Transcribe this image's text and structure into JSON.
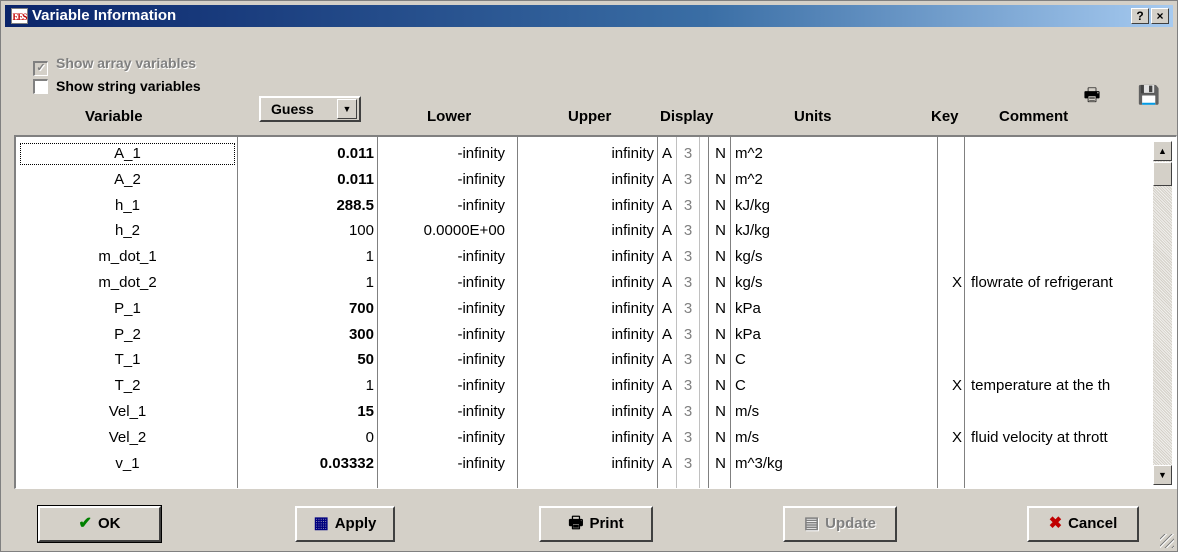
{
  "window": {
    "title": "Variable Information",
    "icon_text": "EES",
    "help_label": "?",
    "close_label": "×"
  },
  "options": {
    "show_array_label": "Show array variables",
    "show_array_checked": true,
    "show_string_label": "Show string variables",
    "show_string_checked": false,
    "checkmark": "✓"
  },
  "toolbar": {
    "print_icon": "printer-icon",
    "save_icon": "floppy-disk-icon",
    "print_glyph": "🖶",
    "save_glyph": "💾"
  },
  "headers": {
    "variable": "Variable",
    "guess": "Guess",
    "lower": "Lower",
    "upper": "Upper",
    "display": "Display",
    "units": "Units",
    "key": "Key",
    "comment": "Comment"
  },
  "guess_arrow": "▼",
  "rows": [
    {
      "var": "A_1",
      "guess": "0.011",
      "bold": true,
      "lower": "-infinity",
      "upper": "infinity",
      "fmt": "A",
      "digits": "3",
      "uflag": "N",
      "units": "m^2",
      "key": "",
      "comment": ""
    },
    {
      "var": "A_2",
      "guess": "0.011",
      "bold": true,
      "lower": "-infinity",
      "upper": "infinity",
      "fmt": "A",
      "digits": "3",
      "uflag": "N",
      "units": "m^2",
      "key": "",
      "comment": ""
    },
    {
      "var": "h_1",
      "guess": "288.5",
      "bold": true,
      "lower": "-infinity",
      "upper": "infinity",
      "fmt": "A",
      "digits": "3",
      "uflag": "N",
      "units": "kJ/kg",
      "key": "",
      "comment": ""
    },
    {
      "var": "h_2",
      "guess": "100",
      "bold": false,
      "lower": "0.0000E+00",
      "upper": "infinity",
      "fmt": "A",
      "digits": "3",
      "uflag": "N",
      "units": "kJ/kg",
      "key": "",
      "comment": ""
    },
    {
      "var": "m_dot_1",
      "guess": "1",
      "bold": false,
      "lower": "-infinity",
      "upper": "infinity",
      "fmt": "A",
      "digits": "3",
      "uflag": "N",
      "units": "kg/s",
      "key": "",
      "comment": ""
    },
    {
      "var": "m_dot_2",
      "guess": "1",
      "bold": false,
      "lower": "-infinity",
      "upper": "infinity",
      "fmt": "A",
      "digits": "3",
      "uflag": "N",
      "units": "kg/s",
      "key": "X",
      "comment": "flowrate of refrigerant"
    },
    {
      "var": "P_1",
      "guess": "700",
      "bold": true,
      "lower": "-infinity",
      "upper": "infinity",
      "fmt": "A",
      "digits": "3",
      "uflag": "N",
      "units": "kPa",
      "key": "",
      "comment": ""
    },
    {
      "var": "P_2",
      "guess": "300",
      "bold": true,
      "lower": "-infinity",
      "upper": "infinity",
      "fmt": "A",
      "digits": "3",
      "uflag": "N",
      "units": "kPa",
      "key": "",
      "comment": ""
    },
    {
      "var": "T_1",
      "guess": "50",
      "bold": true,
      "lower": "-infinity",
      "upper": "infinity",
      "fmt": "A",
      "digits": "3",
      "uflag": "N",
      "units": "C",
      "key": "",
      "comment": ""
    },
    {
      "var": "T_2",
      "guess": "1",
      "bold": false,
      "lower": "-infinity",
      "upper": "infinity",
      "fmt": "A",
      "digits": "3",
      "uflag": "N",
      "units": "C",
      "key": "X",
      "comment": "temperature at the th"
    },
    {
      "var": "Vel_1",
      "guess": "15",
      "bold": true,
      "lower": "-infinity",
      "upper": "infinity",
      "fmt": "A",
      "digits": "3",
      "uflag": "N",
      "units": "m/s",
      "key": "",
      "comment": ""
    },
    {
      "var": "Vel_2",
      "guess": "0",
      "bold": false,
      "lower": "-infinity",
      "upper": "infinity",
      "fmt": "A",
      "digits": "3",
      "uflag": "N",
      "units": "m/s",
      "key": "X",
      "comment": "fluid velocity at thrott"
    },
    {
      "var": "v_1",
      "guess": "0.03332",
      "bold": true,
      "lower": "-infinity",
      "upper": "infinity",
      "fmt": "A",
      "digits": "3",
      "uflag": "N",
      "units": "m^3/kg",
      "key": "",
      "comment": ""
    }
  ],
  "scroll": {
    "up": "▲",
    "down": "▼"
  },
  "buttons": {
    "ok": {
      "label": "OK",
      "icon": "✔",
      "icon_color": "#008000"
    },
    "apply": {
      "label": "Apply",
      "icon": "▦",
      "icon_color": "#000080"
    },
    "print": {
      "label": "Print",
      "icon": "🖶",
      "icon_color": "#000000"
    },
    "update": {
      "label": "Update",
      "icon": "▤",
      "icon_color": "#808080"
    },
    "cancel": {
      "label": "Cancel",
      "icon": "✖",
      "icon_color": "#c00000"
    }
  }
}
